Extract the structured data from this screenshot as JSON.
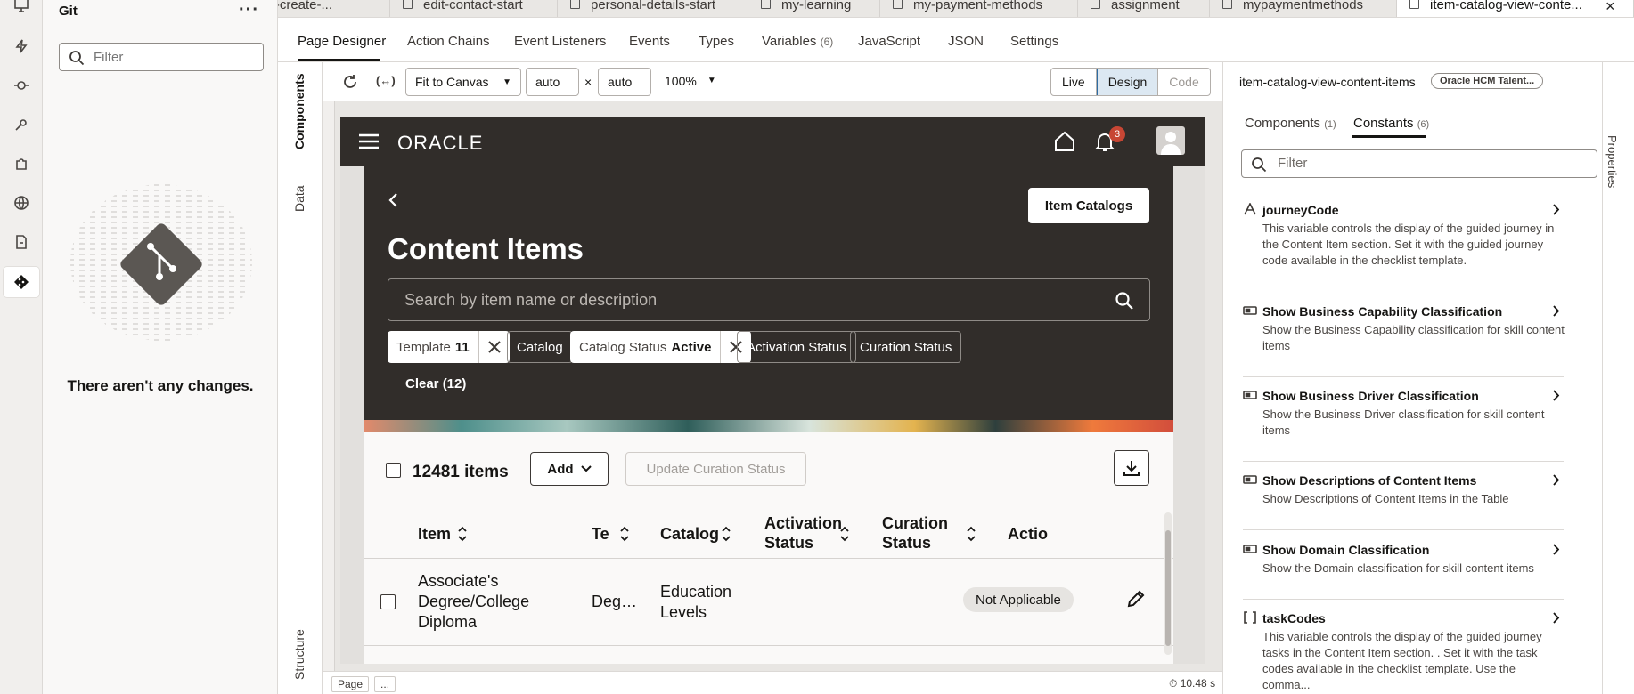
{
  "activity_bar": {
    "icons": [
      "monitor-icon",
      "lightning-icon",
      "event-icon",
      "flow-icon",
      "component-icon",
      "globe-icon",
      "document-icon",
      "git-icon"
    ]
  },
  "git_panel": {
    "title": "Git",
    "more": "···",
    "filter_placeholder": "Filter",
    "empty_message": "There aren't any changes."
  },
  "file_tabs": [
    {
      "label": "ls-create-..."
    },
    {
      "label": "edit-contact-start"
    },
    {
      "label": "personal-details-start"
    },
    {
      "label": "my-learning"
    },
    {
      "label": "my-payment-methods"
    },
    {
      "label": "assignment"
    },
    {
      "label": "mypaymentmethods"
    },
    {
      "label": "item-catalog-view-conte..."
    }
  ],
  "designer_tabs": [
    {
      "label": "Page Designer",
      "count": ""
    },
    {
      "label": "Action Chains",
      "count": ""
    },
    {
      "label": "Event Listeners",
      "count": ""
    },
    {
      "label": "Events",
      "count": ""
    },
    {
      "label": "Types",
      "count": ""
    },
    {
      "label": "Variables",
      "count": "(6)"
    },
    {
      "label": "JavaScript",
      "count": ""
    },
    {
      "label": "JSON",
      "count": ""
    },
    {
      "label": "Settings",
      "count": ""
    }
  ],
  "side_tabs": {
    "components": "Components",
    "data": "Data",
    "structure": "Structure"
  },
  "toolbar": {
    "fit": "Fit to Canvas",
    "width": "auto",
    "times": "×",
    "height": "auto",
    "zoom": "100%",
    "modes": [
      "Live",
      "Design",
      "Code"
    ]
  },
  "preview": {
    "logo": "ORACLE",
    "notifications": "3",
    "item_catalogs_button": "Item Catalogs",
    "title": "Content Items",
    "search_placeholder": "Search by item name or description",
    "chips": {
      "template_label": "Template",
      "template_value": "11",
      "catalog": "Catalog",
      "catalog_status_label": "Catalog Status",
      "catalog_status_value": "Active",
      "activation_status": "Activation Status",
      "curation_status": "Curation Status"
    },
    "clear": "Clear (12)",
    "items_count": "12481 items",
    "add": "Add",
    "update_curation": "Update Curation Status",
    "columns": {
      "item": "Item",
      "template": "Te",
      "catalog": "Catalog",
      "activation_1": "Activation",
      "activation_2": "Status",
      "curation_1": "Curation",
      "curation_2": "Status",
      "actions": "Actio"
    },
    "row": {
      "item_1": "Associate's",
      "item_2": "Degree/College",
      "item_3": "Diploma",
      "template": "Deg…",
      "catalog_1": "Education",
      "catalog_2": "Levels",
      "curation": "Not Applicable"
    }
  },
  "bottom": {
    "crumb_page": "Page",
    "crumb_more": "...",
    "timer": "10.48 s"
  },
  "properties": {
    "title": "item-catalog-view-content-items",
    "badge": "Oracle HCM Talent...",
    "tabs": [
      {
        "label": "Components",
        "count": "(1)"
      },
      {
        "label": "Constants",
        "count": "(6)"
      }
    ],
    "filter_placeholder": "Filter",
    "constants": [
      {
        "name": "journeyCode",
        "type_icon": "string-icon",
        "desc": "This variable controls the display of the guided journey in the Content Item section. Set it with the guided journey code available in the checklist template."
      },
      {
        "name": "Show Business Capability Classification",
        "type_icon": "boolean-icon",
        "desc": "Show the Business Capability classification for skill content items"
      },
      {
        "name": "Show Business Driver Classification",
        "type_icon": "boolean-icon",
        "desc": "Show the Business Driver classification for skill content items"
      },
      {
        "name": "Show Descriptions of Content Items",
        "type_icon": "boolean-icon",
        "desc": "Show Descriptions of Content Items in the Table"
      },
      {
        "name": "Show Domain Classification",
        "type_icon": "boolean-icon",
        "desc": "Show the Domain classification for skill content items"
      },
      {
        "name": "taskCodes",
        "type_icon": "array-icon",
        "desc": "This variable controls the display of the guided journey tasks in the Content Item section. . Set it with the task codes available in the checklist template. Use the comma..."
      }
    ],
    "right_strip": "Properties"
  }
}
